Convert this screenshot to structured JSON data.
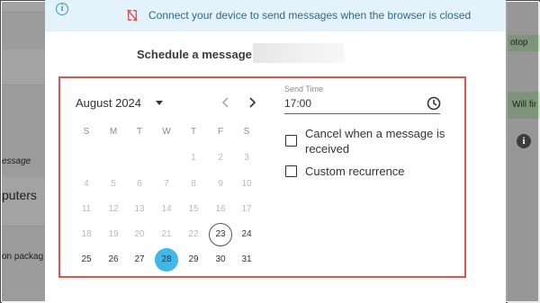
{
  "background": {
    "left_items": [
      "essage",
      "puters",
      "on packag"
    ],
    "right_items": [
      "otop",
      "Will fir"
    ]
  },
  "banner": {
    "text": "Connect your device to send messages when the browser is closed",
    "icon": "info-icon",
    "status_icon": "sync-off-icon"
  },
  "schedule": {
    "label": "Schedule a message to"
  },
  "calendar": {
    "month_label": "August 2024",
    "weekdays": [
      "S",
      "M",
      "T",
      "W",
      "T",
      "F",
      "S"
    ],
    "weeks": [
      [
        null,
        null,
        null,
        null,
        "1",
        "2",
        "3"
      ],
      [
        "4",
        "5",
        "6",
        "7",
        "8",
        "9",
        "10"
      ],
      [
        "11",
        "12",
        "13",
        "14",
        "15",
        "16",
        "17"
      ],
      [
        "18",
        "19",
        "20",
        "21",
        "22",
        "23",
        "24"
      ],
      [
        "25",
        "26",
        "27",
        "28",
        "29",
        "30",
        "31"
      ]
    ],
    "today": "23",
    "selected": "28",
    "first_enabled_day": 23
  },
  "send_time": {
    "label": "Send Time",
    "value": "17:00"
  },
  "options": {
    "cancel_label": "Cancel when a message is received",
    "cancel_line1": "Cancel when a message is",
    "cancel_line2": "received",
    "cancel_checked": false,
    "recurrence_label": "Custom recurrence",
    "recurrence_checked": false
  },
  "colors": {
    "accent": "#3fb7e8",
    "highlight_border": "#e35151",
    "banner_bg": "#e3f2fb"
  }
}
